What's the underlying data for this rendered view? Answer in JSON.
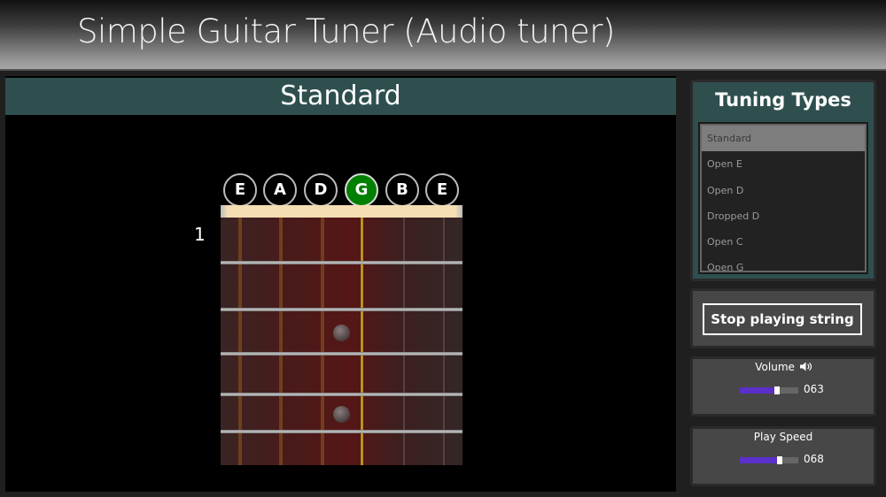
{
  "app": {
    "title": "Simple Guitar Tuner (Audio tuner)"
  },
  "main": {
    "tuning_name": "Standard",
    "fret_number": "1",
    "strings": [
      {
        "note": "E",
        "active": false
      },
      {
        "note": "A",
        "active": false
      },
      {
        "note": "D",
        "active": false
      },
      {
        "note": "G",
        "active": true
      },
      {
        "note": "B",
        "active": false
      },
      {
        "note": "E",
        "active": false
      }
    ],
    "active_color": "#008000"
  },
  "sidebar": {
    "tuning_types_title": "Tuning Types",
    "tuning_types": [
      {
        "label": "Standard",
        "selected": true
      },
      {
        "label": "Open E",
        "selected": false
      },
      {
        "label": "Open D",
        "selected": false
      },
      {
        "label": "Dropped D",
        "selected": false
      },
      {
        "label": "Open C",
        "selected": false
      },
      {
        "label": "Open G",
        "selected": false
      }
    ],
    "stop_button_label": "Stop playing string",
    "volume": {
      "label": "Volume",
      "icon": "speaker-icon",
      "value": 63,
      "display": "063",
      "max": 100
    },
    "play_speed": {
      "label": "Play Speed",
      "value": 68,
      "display": "068",
      "max": 100
    },
    "slider_color": "#5b2fc9"
  }
}
